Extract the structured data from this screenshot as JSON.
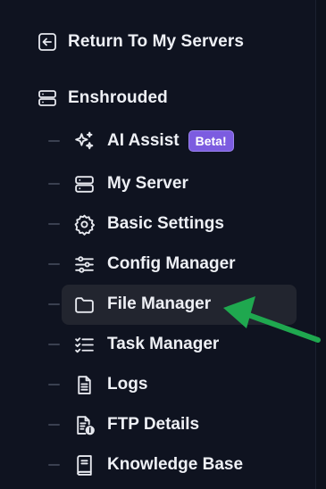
{
  "nav": {
    "return_label": "Return To My Servers",
    "game_label": "Enshrouded",
    "items": [
      {
        "label": "AI Assist",
        "icon": "sparkles-icon",
        "badge": "Beta!"
      },
      {
        "label": "My Server",
        "icon": "server-icon"
      },
      {
        "label": "Basic Settings",
        "icon": "gear-icon"
      },
      {
        "label": "Config Manager",
        "icon": "sliders-icon"
      },
      {
        "label": "File Manager",
        "icon": "folder-icon",
        "active": true
      },
      {
        "label": "Task Manager",
        "icon": "checklist-icon"
      },
      {
        "label": "Logs",
        "icon": "document-icon"
      },
      {
        "label": "FTP Details",
        "icon": "file-info-icon"
      },
      {
        "label": "Knowledge Base",
        "icon": "book-icon"
      }
    ]
  },
  "colors": {
    "background": "#0f1320",
    "active_item": "#22252f",
    "badge": "#7c5ce0",
    "annotation_arrow": "#1fa84f"
  }
}
